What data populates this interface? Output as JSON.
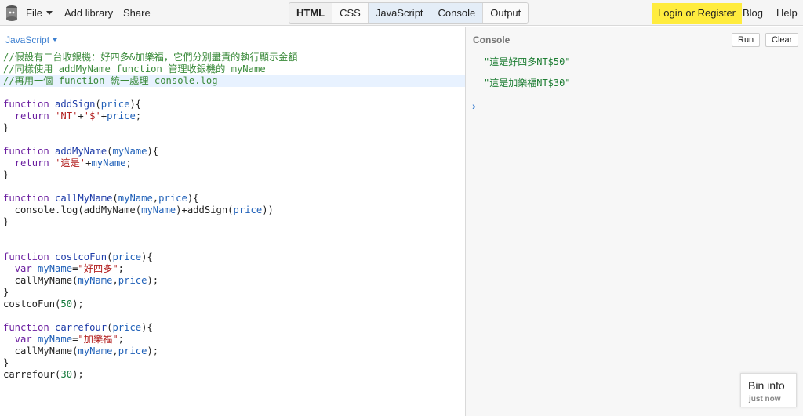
{
  "topbar": {
    "menus": {
      "file": "File",
      "add_library": "Add library",
      "share": "Share"
    },
    "tabs": [
      "HTML",
      "CSS",
      "JavaScript",
      "Console",
      "Output"
    ],
    "login": "Login or Register",
    "blog": "Blog",
    "help": "Help"
  },
  "editor": {
    "language": "JavaScript",
    "lines": [
      "//假設有二台收銀機：好四多&加樂福，它們分別盡責的執行顯示金額",
      "//同樣使用 addMyName function 管理收銀機的 myName",
      "//再用一個 function 統一處理 console.log",
      "",
      "function addSign(price){",
      "  return 'NT'+'$'+price;",
      "}",
      "",
      "function addMyName(myName){",
      "  return '這是'+myName;",
      "}",
      "",
      "function callMyName(myName,price){",
      "  console.log(addMyName(myName)+addSign(price))",
      "}",
      "",
      "",
      "function costcoFun(price){",
      "  var myName=\"好四多\";",
      "  callMyName(myName,price);",
      "}",
      "costcoFun(50);",
      "",
      "function carrefour(price){",
      "  var myName=\"加樂福\";",
      "  callMyName(myName,price);",
      "}",
      "carrefour(30);"
    ]
  },
  "console": {
    "title": "Console",
    "run": "Run",
    "clear": "Clear",
    "output": [
      "\"這是好四多NT$50\"",
      "\"這是加樂福NT$30\""
    ],
    "prompt": "›"
  },
  "bin_info": {
    "title": "Bin info",
    "subtitle": "just now"
  },
  "colors": {
    "accent": "#3c7fd0",
    "login_bg": "#ffec3e",
    "console_text": "#1e7e34",
    "comment": "#3a8a3a"
  }
}
